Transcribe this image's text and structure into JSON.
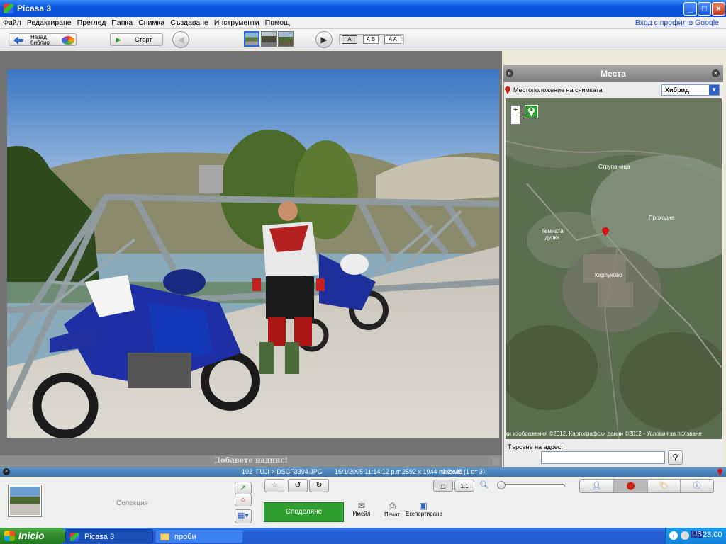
{
  "window": {
    "title": "Picasa 3",
    "minimize": "_",
    "maximize": "□",
    "close": "×"
  },
  "menu": {
    "items": [
      "Файл",
      "Редактиране",
      "Преглед",
      "Папка",
      "Снимка",
      "Създаване",
      "Инструменти",
      "Помощ"
    ],
    "login_link": "Вход с профил в Google"
  },
  "toolbar": {
    "back_label_1": "Назад",
    "back_label_2": "библио",
    "start_label": "Старт",
    "view_a": "A",
    "view_ab": "A B",
    "view_aa": "A A"
  },
  "photo": {
    "caption_placeholder": "Добавете надпис!"
  },
  "places": {
    "title": "Места",
    "location_label": "Местоположение на снимката",
    "map_type": "Хибрид",
    "zoom_in": "+",
    "zoom_out": "−",
    "labels": [
      "Струпаница",
      "Проходна",
      "Темната дупка",
      "Карлуково"
    ],
    "attribution": "ки изображения ©2012, Картографски данни ©2012 - Условия за ползване",
    "search_label": "Търсене на адрес:",
    "search_value": ""
  },
  "status": {
    "path": "102_FUJI > DSCF3394.JPG",
    "date": "16/1/2005 11:14:12 p.m.",
    "dims": "2592 x 1944 пиксела",
    "size": "1,2 МБ",
    "index": "(1 от 3)"
  },
  "tray": {
    "selection": "Селекция",
    "share": "Споделяне",
    "email": "Имейл",
    "print": "Печат",
    "export": "Експортиране",
    "zoom_fraction": 0.0
  },
  "taskbar": {
    "start": "Inicio",
    "task1": "Picasa 3",
    "task2": "проби",
    "lang": "US",
    "clock": "23:00"
  },
  "colors": {
    "titlebar": "#0a54e0",
    "share_button": "#2e9c2e",
    "statusbar": "#4a85bb",
    "taskbar": "#245ed6"
  }
}
